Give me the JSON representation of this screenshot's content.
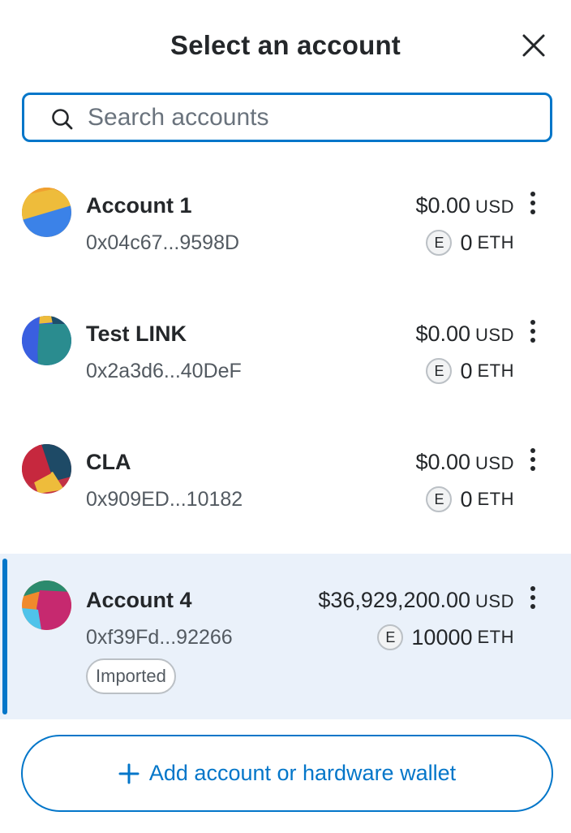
{
  "header": {
    "title": "Select an account",
    "close_icon": "close-icon"
  },
  "search": {
    "placeholder": "Search accounts",
    "value": "",
    "icon": "search-icon"
  },
  "accounts": [
    {
      "name": "Account 1",
      "address": "0x04c67...9598D",
      "fiat_value": "$0.00",
      "fiat_unit": "USD",
      "eth_badge": "E",
      "native_value": "0",
      "native_unit": "ETH",
      "selected": false,
      "tag": ""
    },
    {
      "name": "Test LINK",
      "address": "0x2a3d6...40DeF",
      "fiat_value": "$0.00",
      "fiat_unit": "USD",
      "eth_badge": "E",
      "native_value": "0",
      "native_unit": "ETH",
      "selected": false,
      "tag": ""
    },
    {
      "name": "CLA",
      "address": "0x909ED...10182",
      "fiat_value": "$0.00",
      "fiat_unit": "USD",
      "eth_badge": "E",
      "native_value": "0",
      "native_unit": "ETH",
      "selected": false,
      "tag": ""
    },
    {
      "name": "Account 4",
      "address": "0xf39Fd...92266",
      "fiat_value": "$36,929,200.00",
      "fiat_unit": "USD",
      "eth_badge": "E",
      "native_value": "10000",
      "native_unit": "ETH",
      "selected": true,
      "tag": "Imported"
    }
  ],
  "footer": {
    "add_label": "Add account or hardware wallet",
    "add_icon": "plus-icon"
  },
  "colors": {
    "primary": "#0376c9",
    "selected_bg": "#eaf1fa",
    "text": "#24272a",
    "muted": "#535a61"
  }
}
